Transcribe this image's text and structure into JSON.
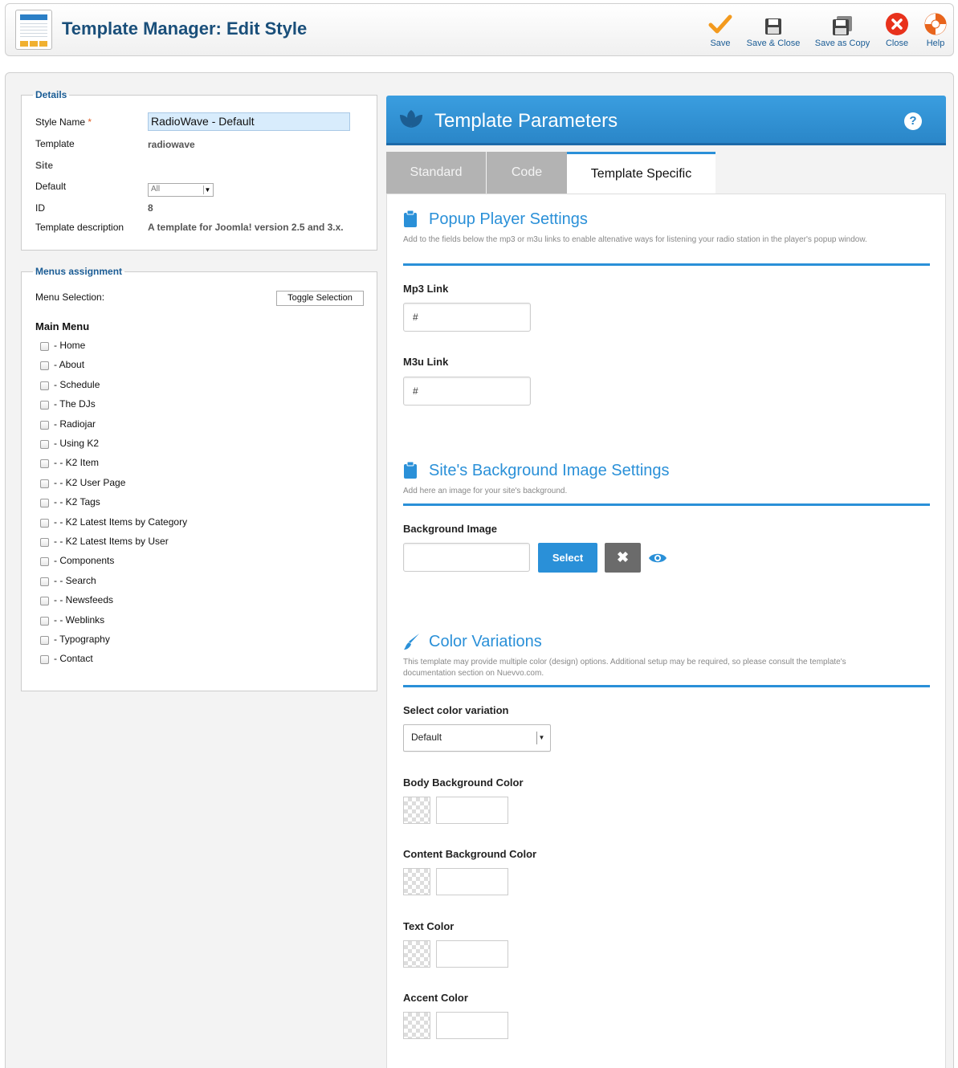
{
  "header": {
    "title": "Template Manager: Edit Style",
    "toolbar": [
      {
        "label": "Save",
        "icon": "check-icon"
      },
      {
        "label": "Save & Close",
        "icon": "floppy-icon"
      },
      {
        "label": "Save as Copy",
        "icon": "floppy-copy-icon"
      },
      {
        "label": "Close",
        "icon": "close-circle-icon"
      },
      {
        "label": "Help",
        "icon": "lifebuoy-icon"
      }
    ]
  },
  "details": {
    "legend": "Details",
    "style_name_label": "Style Name",
    "required_mark": "*",
    "style_name_value": "RadioWave - Default",
    "template_label": "Template",
    "template_value": "radiowave",
    "site_label": "Site",
    "default_label": "Default",
    "default_value": "All",
    "id_label": "ID",
    "id_value": "8",
    "description_label": "Template description",
    "description_value": "A template for Joomla! version 2.5 and 3.x."
  },
  "menus": {
    "legend": "Menus assignment",
    "selection_label": "Menu Selection:",
    "toggle_label": "Toggle Selection",
    "main_menu_title": "Main Menu",
    "items": [
      "- Home",
      "- About",
      "- Schedule",
      "- The DJs",
      "- Radiojar",
      "- Using K2",
      "- - K2 Item",
      "- - K2 User Page",
      "- - K2 Tags",
      "- - K2 Latest Items by Category",
      "- - K2 Latest Items by User",
      "- Components",
      "- - Search",
      "- - Newsfeeds",
      "- - Weblinks",
      "- Typography",
      "- Contact"
    ]
  },
  "params": {
    "title": "Template Parameters",
    "help": "?",
    "tabs": [
      "Standard",
      "Code",
      "Template Specific"
    ],
    "active_tab": "Template Specific",
    "popup": {
      "title": "Popup Player Settings",
      "desc": "Add to the fields below the mp3 or m3u links to enable altenative ways for listening your radio station in the player's popup window.",
      "mp3_label": "Mp3 Link",
      "mp3_value": "#",
      "m3u_label": "M3u Link",
      "m3u_value": "#"
    },
    "background": {
      "title": "Site's Background Image Settings",
      "desc": "Add here an image for your site's background.",
      "image_label": "Background Image",
      "image_value": "",
      "select_label": "Select",
      "clear_label": "✖"
    },
    "colors": {
      "title": "Color Variations",
      "desc": "This template may provide multiple color (design) options. Additional setup may be required, so please consult the template's documentation section on Nuevvo.com.",
      "variation_label": "Select color variation",
      "variation_value": "Default",
      "body_label": "Body Background Color",
      "content_label": "Content Background Color",
      "text_label": "Text Color",
      "accent_label": "Accent Color"
    }
  },
  "colors_theme": {
    "accent": "#2a90d8",
    "title_blue": "#1a4f7a",
    "link_blue": "#1a5c95"
  }
}
